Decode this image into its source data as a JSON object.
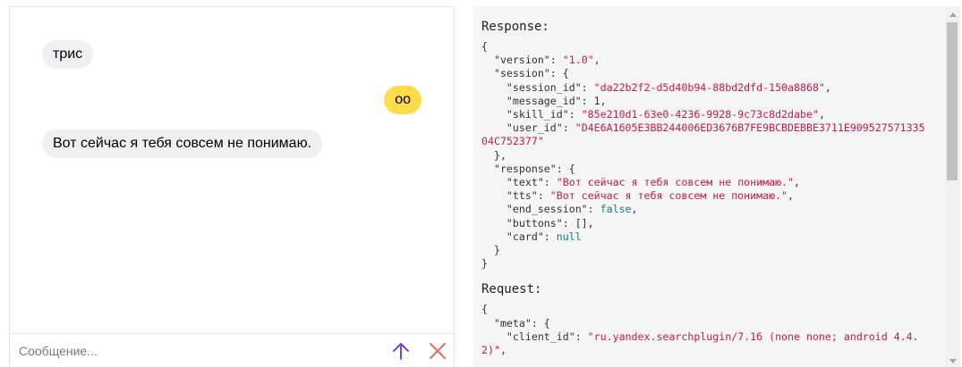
{
  "chat": {
    "messages": [
      {
        "author": "bot",
        "text": "трис"
      },
      {
        "author": "user",
        "text": "оо"
      },
      {
        "author": "bot",
        "text": "Вот сейчас я тебя совсем не понимаю."
      }
    ],
    "input": {
      "value": "",
      "placeholder": "Сообщение..."
    },
    "send_icon": "arrow-up-icon",
    "clear_icon": "close-icon",
    "colors": {
      "user_bubble": "#ffdb4d",
      "bot_bubble": "#f0f0f3",
      "send_icon": "#7b3ff2",
      "clear_icon": "#e06b6b"
    }
  },
  "log": {
    "response_heading": "Response:",
    "request_heading": "Request:",
    "response": {
      "version": "1.0",
      "session": {
        "session_id": "da22b2f2-d5d40b94-88bd2dfd-150a8868",
        "message_id": "1",
        "skill_id": "85e210d1-63e0-4236-9928-9c73c8d2dabe",
        "user_id_line1": "D4E6A1605E3BB244006ED3676B7FE9BCBDEBBE3711E909527571335",
        "user_id_line2": "04C752377"
      },
      "response": {
        "text": "Вот сейчас я тебя совсем не понимаю.",
        "tts": "Вот сейчас я тебя совсем не понимаю.",
        "end_session": "false",
        "buttons": "[]",
        "card": "null"
      }
    },
    "request": {
      "client_id_line1": "ru.yandex.searchplugin/7.16 (none none; android 4.4.",
      "client_id_line2": "2)"
    }
  }
}
